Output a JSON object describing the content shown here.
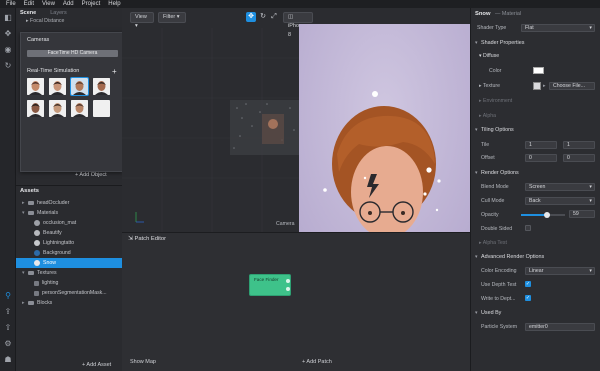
{
  "menu": [
    "File",
    "Edit",
    "View",
    "Add",
    "Project",
    "Help"
  ],
  "scene": {
    "tab_active": "Scene",
    "tab_inactive": "Layers",
    "focal_label": "Focal Distance",
    "add_object": "+ Add Object"
  },
  "cameras_popup": {
    "title": "Cameras",
    "camera_button": "FaceTime HD Camera",
    "sim_title": "Real-Time Simulation",
    "add": "+"
  },
  "assets": {
    "title": "Assets",
    "rows": [
      {
        "label": "headOccluder",
        "kind": "folder"
      },
      {
        "label": "Materials",
        "kind": "folder-open"
      },
      {
        "label": "occlusion_mat",
        "kind": "ball",
        "color": "#9ea1a8"
      },
      {
        "label": "Beautify",
        "kind": "ball",
        "color": "#b7b9be"
      },
      {
        "label": "Lightningtatto",
        "kind": "ball",
        "color": "#c7c9cd"
      },
      {
        "label": "Background",
        "kind": "ball",
        "color": "#2d6ba8"
      },
      {
        "label": "Snow",
        "kind": "ball",
        "color": "#e8e8ea",
        "selected": true
      },
      {
        "label": "Textures",
        "kind": "folder-open"
      },
      {
        "label": "lighting",
        "kind": "plain"
      },
      {
        "label": "personSegmentationMask...",
        "kind": "plain"
      },
      {
        "label": "Blocks",
        "kind": "folder"
      }
    ],
    "add_asset": "+ Add Asset"
  },
  "viewport": {
    "view": "View",
    "filter": "Filter",
    "device": "iPhone 8",
    "camera_label": "Camera"
  },
  "patch_editor": {
    "title": "Patch Editor",
    "node": "Face Finder",
    "show_map": "Show Map",
    "add_patch": "+ Add Patch"
  },
  "inspector": {
    "object_name": "Snow",
    "object_type": "— Material",
    "shader_type_label": "Shader Type",
    "shader_type_value": "Flat",
    "sec_shader": "Shader Properties",
    "diffuse": "Diffuse",
    "color_label": "Color",
    "texture_label": "Texture",
    "texture_value": "Choose File...",
    "environment": "Environment",
    "alpha": "Alpha",
    "sec_tiling": "Tiling Options",
    "tile_label": "Tile",
    "tile_x": "1",
    "tile_y": "1",
    "offset_label": "Offset",
    "offset_x": "0",
    "offset_y": "0",
    "sec_render": "Render Options",
    "blend_label": "Blend Mode",
    "blend_value": "Screen",
    "cull_label": "Cull Mode",
    "cull_value": "Back",
    "opacity_label": "Opacity",
    "opacity_value": "59",
    "opacity_fraction": 0.59,
    "double_label": "Double Sided",
    "alpha_test": "Alpha Test",
    "sec_adv": "Advanced Render Options",
    "encoding_label": "Color Encoding",
    "encoding_value": "Linear",
    "depth_test": "Use Depth Test",
    "depth_write": "Write to Dept...",
    "sec_used": "Used By",
    "particle_label": "Particle System",
    "particle_value": "emitter0"
  }
}
